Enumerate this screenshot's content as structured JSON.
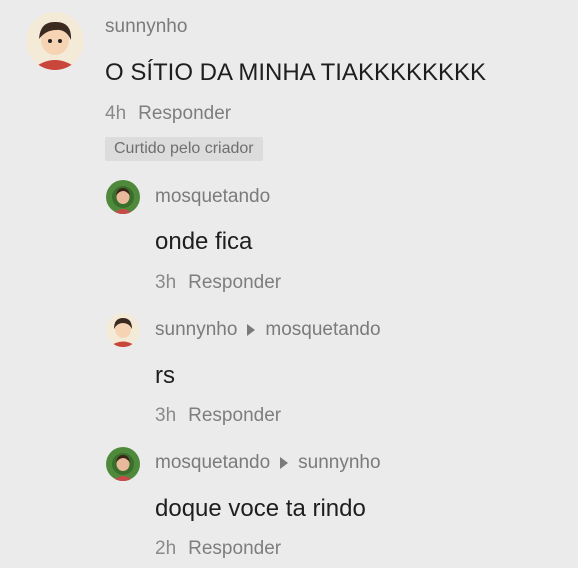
{
  "comment": {
    "username": "sunnynho",
    "text": "O SÍTIO DA MINHA TIAKKKKKKKK",
    "time": "4h",
    "reply_label": "Responder",
    "badge": "Curtido pelo criador"
  },
  "replies": [
    {
      "username": "mosquetando",
      "reply_to": "",
      "text": "onde fica",
      "time": "3h",
      "reply_label": "Responder"
    },
    {
      "username": "sunnynho",
      "reply_to": "mosquetando",
      "text": "rs",
      "time": "3h",
      "reply_label": "Responder"
    },
    {
      "username": "mosquetando",
      "reply_to": "sunnynho",
      "text": "doque voce ta rindo",
      "time": "2h",
      "reply_label": "Responder"
    }
  ]
}
